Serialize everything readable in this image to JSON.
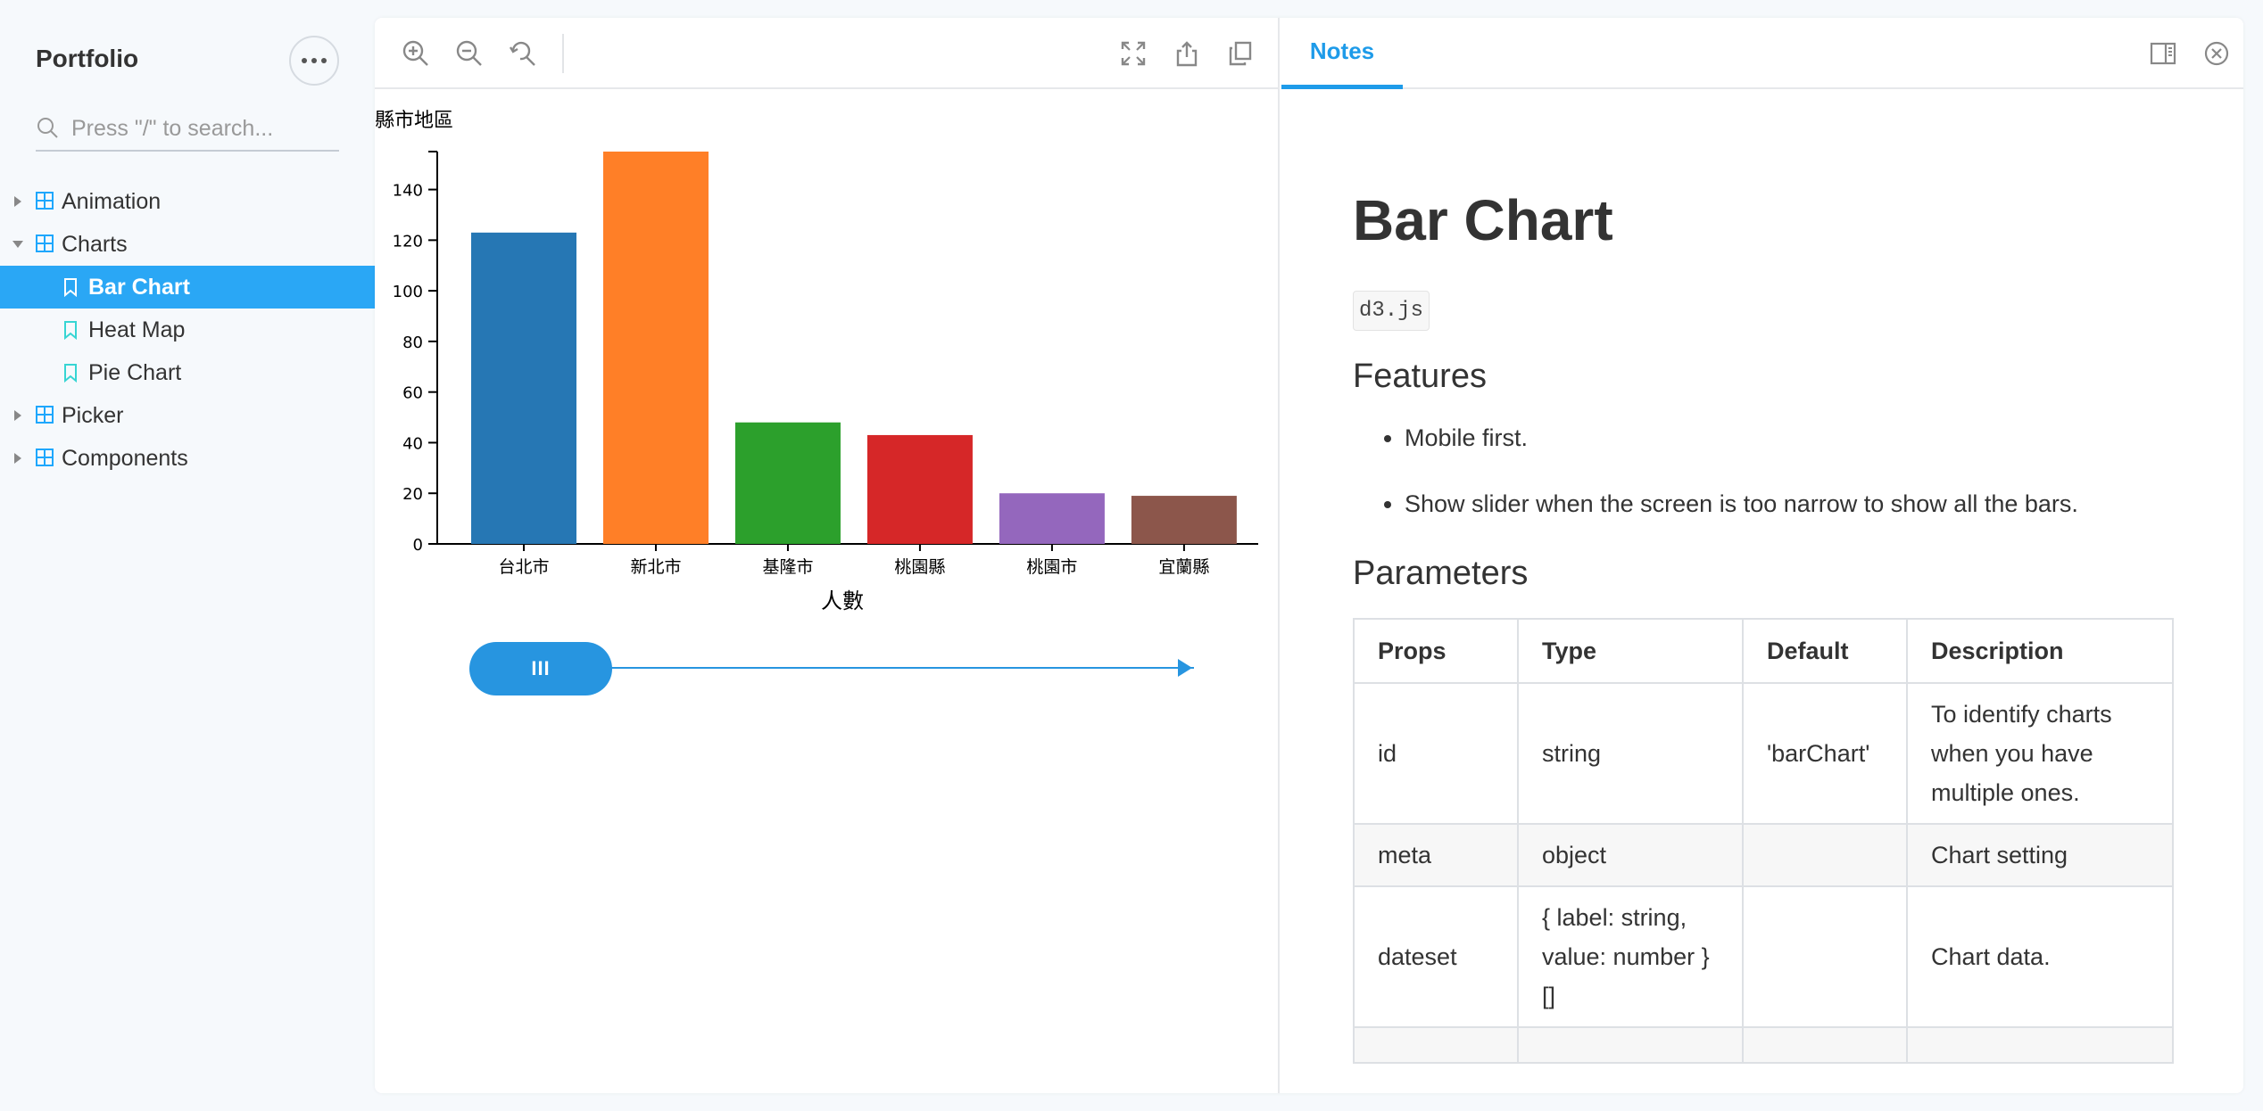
{
  "sidebar": {
    "brand": "Portfolio",
    "more_icon": "ellipsis-icon",
    "search": {
      "placeholder": "Press \"/\" to search..."
    },
    "tree": [
      {
        "label": "Animation",
        "type": "folder",
        "expanded": false
      },
      {
        "label": "Charts",
        "type": "folder",
        "expanded": true
      },
      {
        "label": "Bar Chart",
        "type": "story",
        "active": true
      },
      {
        "label": "Heat Map",
        "type": "story"
      },
      {
        "label": "Pie Chart",
        "type": "story"
      },
      {
        "label": "Picker",
        "type": "folder",
        "expanded": false
      },
      {
        "label": "Components",
        "type": "folder",
        "expanded": false
      }
    ]
  },
  "toolbar": {
    "icons": [
      "zoom-in-icon",
      "zoom-out-icon",
      "reset-zoom-icon",
      "fullscreen-icon",
      "share-icon",
      "copy-icon"
    ]
  },
  "chart_data": {
    "type": "bar",
    "title": "縣市地區",
    "xlabel": "人數",
    "ylabel": "",
    "categories": [
      "台北市",
      "新北市",
      "基隆市",
      "桃園縣",
      "桃園市",
      "宜蘭縣"
    ],
    "values": [
      123,
      155,
      48,
      43,
      20,
      19
    ],
    "colors": [
      "#2677b4",
      "#ff7f27",
      "#2ca02c",
      "#d62728",
      "#9467bd",
      "#8c564b"
    ],
    "ylim": [
      0,
      155
    ],
    "yticks": [
      0,
      20,
      40,
      60,
      80,
      100,
      120,
      140
    ],
    "grid": false
  },
  "slider": {
    "handle_label": "III"
  },
  "notes": {
    "tab_label": "Notes",
    "title": "Bar Chart",
    "code_tag": "d3.js",
    "features_heading": "Features",
    "features": [
      "Mobile first.",
      "Show slider when the screen is too narrow to show all the bars."
    ],
    "parameters_heading": "Parameters",
    "table": {
      "headers": [
        "Props",
        "Type",
        "Default",
        "Description"
      ],
      "rows": [
        [
          "id",
          "string",
          "'barChart'",
          "To identify charts when you have multiple ones."
        ],
        [
          "meta",
          "object",
          "",
          "Chart setting"
        ],
        [
          "dateset",
          "{ label: string, value: number }[]",
          "",
          "Chart data."
        ]
      ]
    }
  }
}
